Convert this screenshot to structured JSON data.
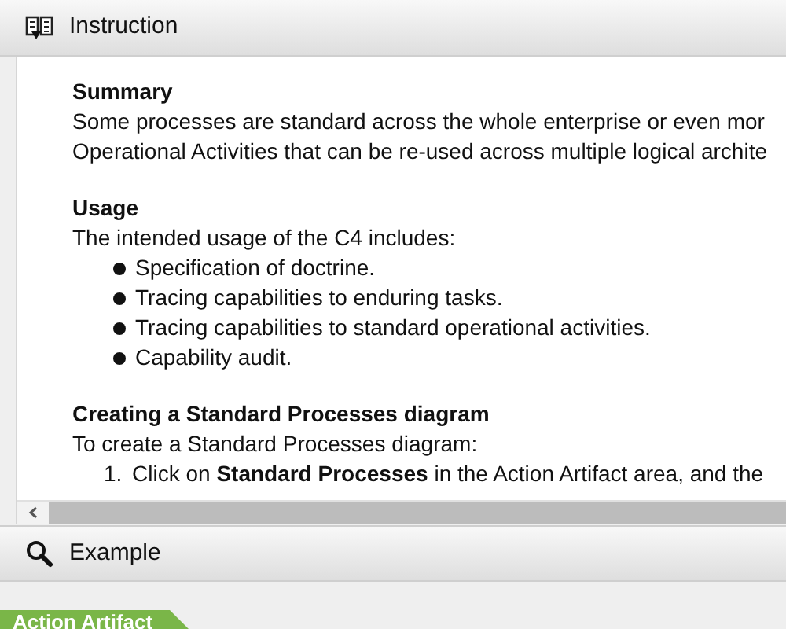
{
  "instruction_panel": {
    "title": "Instruction",
    "sections": [
      {
        "heading": "Summary",
        "paragraphs": [
          "Some processes are standard across the whole enterprise or even mor",
          "Operational Activities that can be re-used across multiple logical archite"
        ]
      },
      {
        "heading": "Usage",
        "paragraphs": [
          "The intended usage of the C4 includes:"
        ],
        "bullets": [
          "Specification of doctrine.",
          "Tracing capabilities to enduring tasks.",
          "Tracing capabilities to standard operational activities.",
          "Capability audit."
        ]
      },
      {
        "heading": "Creating a Standard Processes diagram",
        "paragraphs": [
          "To create a Standard Processes diagram:"
        ],
        "steps": [
          {
            "number": "1.",
            "text": "Click on **Standard Processes** in the Action Artifact area, and the"
          }
        ]
      }
    ]
  },
  "example_panel": {
    "title": "Example"
  },
  "tab": {
    "label": "Action Artifact"
  }
}
